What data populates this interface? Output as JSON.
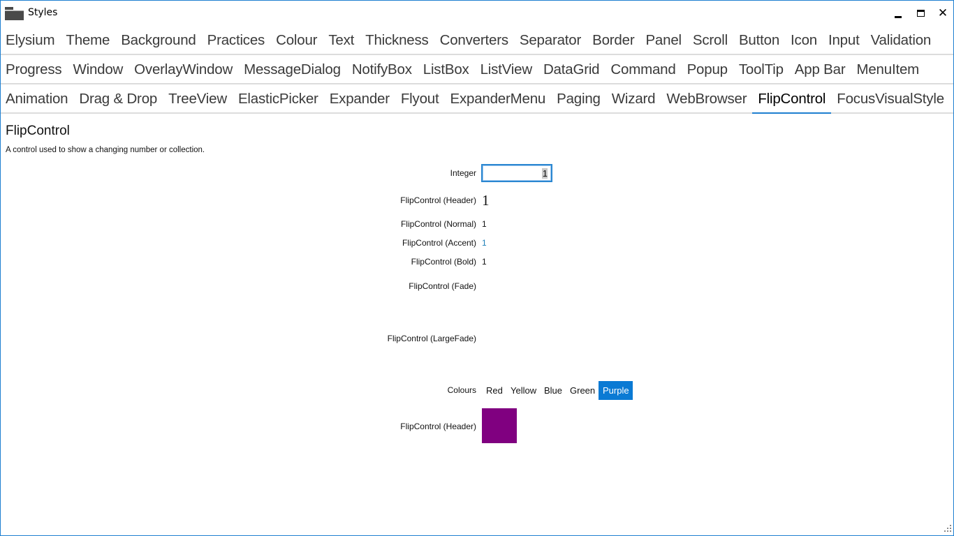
{
  "window": {
    "title": "Styles",
    "icon": "folder-icon",
    "controls": {
      "minimize": "minimize-icon",
      "maximize": "maximize-icon",
      "close": "✕"
    }
  },
  "tabs": {
    "rows": [
      [
        "Elysium",
        "Theme",
        "Background",
        "Practices",
        "Colour",
        "Text",
        "Thickness",
        "Converters",
        "Separator",
        "Border",
        "Panel",
        "Scroll",
        "Button",
        "Icon",
        "Input",
        "Validation"
      ],
      [
        "Progress",
        "Window",
        "OverlayWindow",
        "MessageDialog",
        "NotifyBox",
        "ListBox",
        "ListView",
        "DataGrid",
        "Command",
        "Popup",
        "ToolTip",
        "App Bar",
        "MenuItem"
      ],
      [
        "Animation",
        "Drag & Drop",
        "TreeView",
        "ElasticPicker",
        "Expander",
        "Flyout",
        "ExpanderMenu",
        "Paging",
        "Wizard",
        "WebBrowser",
        "FlipControl",
        "FocusVisualStyle"
      ]
    ],
    "active": "FlipControl"
  },
  "page": {
    "title": "FlipControl",
    "description": "A control used to show a changing number or collection."
  },
  "form": {
    "integer": {
      "label": "Integer",
      "value": "1"
    },
    "header": {
      "label": "FlipControl (Header)",
      "value": "1"
    },
    "normal": {
      "label": "FlipControl (Normal)",
      "value": "1"
    },
    "accent": {
      "label": "FlipControl (Accent)",
      "value": "1"
    },
    "bold": {
      "label": "FlipControl (Bold)",
      "value": "1"
    },
    "fade": {
      "label": "FlipControl (Fade)",
      "value": ""
    },
    "large_fade": {
      "label": "FlipControl (LargeFade)",
      "value": ""
    },
    "colours": {
      "label": "Colours",
      "options": [
        "Red",
        "Yellow",
        "Blue",
        "Green",
        "Purple"
      ],
      "selected": "Purple"
    },
    "colour_header": {
      "label": "FlipControl (Header)",
      "swatch_color": "#800080"
    }
  },
  "colors": {
    "accent": "#1e7fd0",
    "accent_text": "#1e7fb8",
    "selected_bg": "#0a7ad4"
  }
}
